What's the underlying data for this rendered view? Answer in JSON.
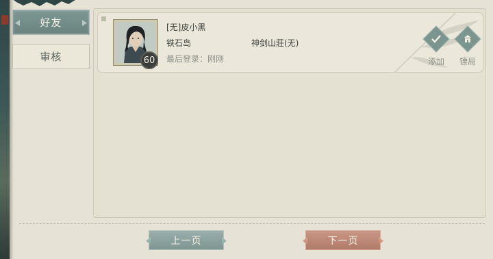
{
  "tabs": {
    "friends": "好友",
    "review": "审核"
  },
  "card": {
    "name": "[无]皮小黑",
    "location": "铁石岛",
    "guild": "神剑山莊(无)",
    "last_login": "最后登录：刚刚",
    "level": "60",
    "add_label": "添加",
    "spar_label": "镖局"
  },
  "pagination": {
    "prev": "上一页",
    "next": "下一页"
  },
  "colors": {
    "accent": "#7d958f",
    "tab_active": "#6f8884",
    "next_button": "#b8826f",
    "prev_button": "#869c98"
  }
}
